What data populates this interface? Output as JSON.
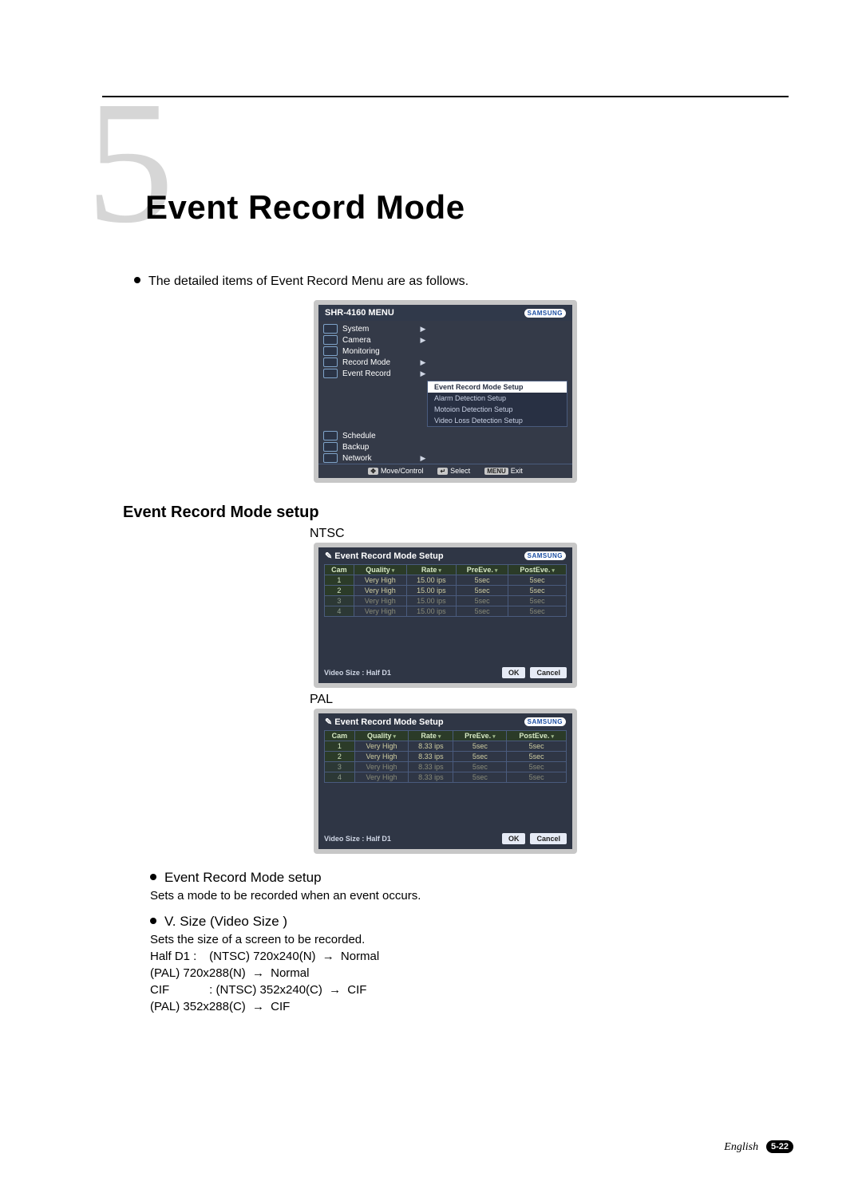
{
  "chapter": {
    "number": "5",
    "title": "Event Record Mode"
  },
  "lead": "The detailed items of Event Record Menu are as follows.",
  "menu_panel": {
    "title": "SHR-4160 MENU",
    "brand": "SAMSUNG",
    "items": [
      {
        "label": "System",
        "arrow": true
      },
      {
        "label": "Camera",
        "arrow": true
      },
      {
        "label": "Monitoring",
        "arrow": false
      },
      {
        "label": "Record Mode",
        "arrow": true
      },
      {
        "label": "Event Record",
        "arrow": true
      },
      {
        "label": "Schedule",
        "arrow": false
      },
      {
        "label": "Backup",
        "arrow": false
      },
      {
        "label": "Network",
        "arrow": true
      }
    ],
    "submenu": [
      "Event Record Mode Setup",
      "Alarm Detection Setup",
      "Motoion Detection Setup",
      "Video Loss Detection Setup"
    ],
    "footer": {
      "move": "Move/Control",
      "select": "Select",
      "exit": "Exit"
    }
  },
  "section_heading": "Event Record Mode setup",
  "ntsc_label": "NTSC",
  "pal_label": "PAL",
  "setup_panel": {
    "title": "Event Record Mode Setup",
    "brand": "SAMSUNG",
    "columns": [
      "Cam",
      "Quality",
      "Rate",
      "PreEve.",
      "PostEve."
    ],
    "video_size": "Video Size : Half D1",
    "ok": "OK",
    "cancel": "Cancel"
  },
  "ntsc_rows": [
    {
      "cam": "1",
      "quality": "Very High",
      "rate": "15.00 ips",
      "pre": "5sec",
      "post": "5sec"
    },
    {
      "cam": "2",
      "quality": "Very High",
      "rate": "15.00 ips",
      "pre": "5sec",
      "post": "5sec"
    },
    {
      "cam": "3",
      "quality": "Very High",
      "rate": "15.00 ips",
      "pre": "5sec",
      "post": "5sec"
    },
    {
      "cam": "4",
      "quality": "Very High",
      "rate": "15.00 ips",
      "pre": "5sec",
      "post": "5sec"
    }
  ],
  "pal_rows": [
    {
      "cam": "1",
      "quality": "Very High",
      "rate": "8.33 ips",
      "pre": "5sec",
      "post": "5sec"
    },
    {
      "cam": "2",
      "quality": "Very High",
      "rate": "8.33 ips",
      "pre": "5sec",
      "post": "5sec"
    },
    {
      "cam": "3",
      "quality": "Very High",
      "rate": "8.33 ips",
      "pre": "5sec",
      "post": "5sec"
    },
    {
      "cam": "4",
      "quality": "Very High",
      "rate": "8.33 ips",
      "pre": "5sec",
      "post": "5sec"
    }
  ],
  "body": {
    "item1_title": "Event Record Mode setup",
    "item1_text": "Sets a mode to be recorded when an event occurs.",
    "item2_title": "V. Size (Video Size )",
    "item2_text": "Sets the size of a screen to be recorded.",
    "halfd1_label": "Half D1 :",
    "cif_label": "CIF",
    "sep": ":",
    "ntsc_halfd1": "(NTSC) 720x240(N)",
    "pal_halfd1": "(PAL) 720x288(N)",
    "ntsc_cif": "(NTSC) 352x240(C)",
    "pal_cif": "(PAL) 352x288(C)",
    "arrow": "→",
    "normal": "Normal",
    "cif": "CIF"
  },
  "footer": {
    "language": "English",
    "page": "5-22"
  }
}
